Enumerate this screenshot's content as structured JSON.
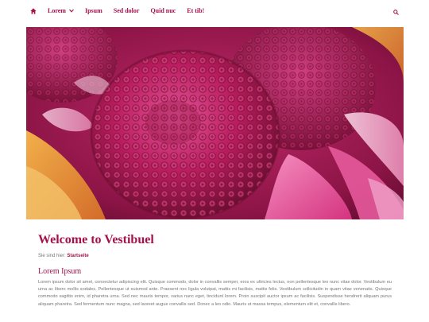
{
  "nav": {
    "items": [
      {
        "label": "Lorem",
        "has_dropdown": true
      },
      {
        "label": "Ipsum"
      },
      {
        "label": "Sed dolor"
      },
      {
        "label": "Quid nuc"
      },
      {
        "label": "Et tib!"
      }
    ]
  },
  "icons": {
    "home": "home-icon",
    "search": "search-icon",
    "chevron": "chevron-down-icon"
  },
  "colors": {
    "accent": "#a5124a",
    "text": "#777777"
  },
  "page": {
    "title": "Welcome to Vestibuel",
    "breadcrumb_prefix": "Sie sind hier:",
    "breadcrumb_current": "Startseite",
    "subtitle": "Lorem Ipsum",
    "paragraph": "Lorem ipsum dolor sit amet, consectetur adipiscing elit. Quisque commodo, dolor in convallis semper, eros ex ultricies lectus, non pellentesque leo nunc vitae dolor. Vestibulum eu urna ac libero mollis sodales. Pellentesque ut euismod ante. Praesent nec ligula volutpat, mattis mi facilisis, mattis felis. Vestibulum sollicitudin in quam vitae venenatis. Quisque commodo sagittis enim, id pharetra urna. Sed nec mauris tempor, varius nunc eget, tincidunt lorem. Proin suscipit auctor ipsum ac facilisis. Suspendisse hendrerit aliquam purus aliquam pharetra. Sed fermentum nunc magna, sed laoreet augue convallis sed. Donec a leo odio. Mauris ut massa tempus, elementum elit et, convallis libero."
  }
}
